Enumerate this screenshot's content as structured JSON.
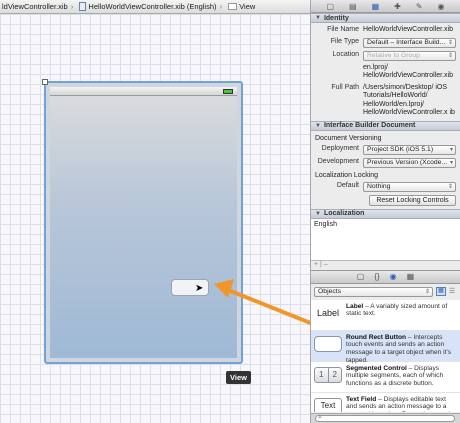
{
  "jumpbar": {
    "crumbs": [
      "ldViewController.xib",
      "HelloWorldViewController.xib (English)",
      "View"
    ]
  },
  "canvas": {
    "view_label": "View"
  },
  "inspector": {
    "toolbar_icons": [
      "file-icon",
      "quick-help-icon",
      "identity-icon",
      "attributes-icon",
      "size-icon",
      "connections-icon"
    ],
    "identity": {
      "header": "Identity",
      "file_name_label": "File Name",
      "file_name": "HelloWorldViewController.xib",
      "file_type_label": "File Type",
      "file_type": "Default – Interface Build...",
      "location_label": "Location",
      "location": "Relative to Group",
      "location_path": "en.lproj/ HelloWorldViewController.xib",
      "full_path_label": "Full Path",
      "full_path": "/Users/simon/Desktop/ iOS Tutorials/HelloWorld/ HelloWorld/en.lproj/ HelloWorldViewController.x ib"
    },
    "ib_document": {
      "header": "Interface Builder Document",
      "versioning_label": "Document Versioning",
      "deployment_label": "Deployment",
      "deployment": "Project SDK (iOS 5.1)",
      "development_label": "Development",
      "development": "Previous Version (Xcode...",
      "locking_label": "Localization Locking",
      "default_label": "Default",
      "default_value": "Nothing",
      "reset_button": "Reset Locking Controls"
    },
    "localization": {
      "header": "Localization",
      "items": [
        "English"
      ],
      "footer": "+ | –"
    }
  },
  "library": {
    "filter": "Objects",
    "items": [
      {
        "thumb": "Label",
        "title": "Label",
        "desc": " – A variably sized amount of static text."
      },
      {
        "thumb": "",
        "title": "Round Rect Button",
        "desc": " – Intercepts touch events and sends an action message to a target object when it's tapped."
      },
      {
        "thumb": "1 2",
        "title": "Segmented Control",
        "desc": " – Displays multiple segments, each of which functions as a discrete button."
      },
      {
        "thumb": "Text",
        "title": "Text Field",
        "desc": " – Displays editable text and sends an action message to a target object when Return is tapped."
      }
    ]
  },
  "colors": {
    "selection_blue": "#6fa3d8",
    "arrow_orange": "#f0962a",
    "selected_row": "#d7e3f6"
  }
}
